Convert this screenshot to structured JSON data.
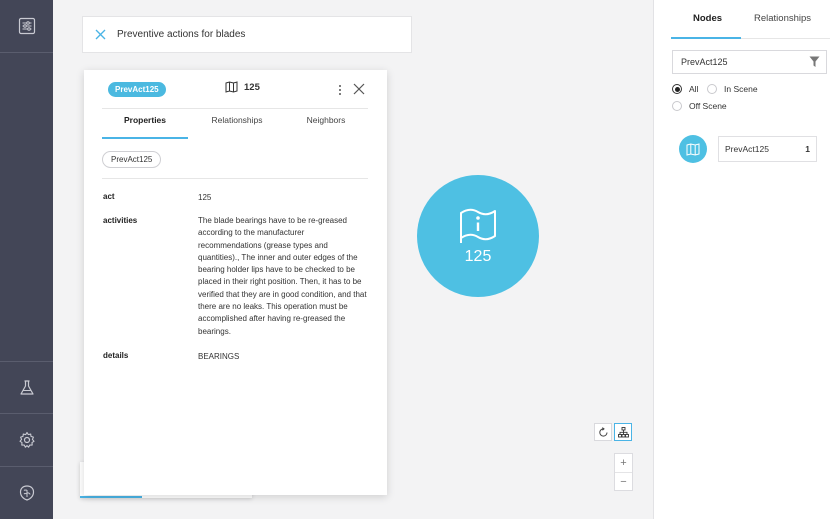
{
  "search": {
    "query": "Preventive actions for blades"
  },
  "card": {
    "badge": "PrevAct125",
    "title": "125",
    "tabs": [
      "Properties",
      "Relationships",
      "Neighbors"
    ],
    "active_tab": "Properties",
    "chip": "PrevAct125",
    "properties": [
      {
        "key": "act",
        "value": "125"
      },
      {
        "key": "activities",
        "value": "The blade bearings have to be re-greased according to the manufacturer recommendations (grease types and quantities)., The inner and outer edges of the bearing holder lips have to be checked to be placed in their right position. Then, it has to be verified that they are in good condition, and that there are no leaks. This operation must be accomplished after having re-greased the bearings."
      },
      {
        "key": "details",
        "value": "BEARINGS"
      }
    ]
  },
  "node": {
    "label": "125",
    "icon": "info-flag-icon",
    "color": "#4ec0e3"
  },
  "zoom": {
    "in": "+",
    "out": "−"
  },
  "right_panel": {
    "tabs": [
      "Nodes",
      "Relationships"
    ],
    "active_tab": "Nodes",
    "filter_value": "PrevAct125",
    "radios": [
      {
        "label": "All",
        "checked": true
      },
      {
        "label": "In Scene",
        "checked": false
      },
      {
        "label": "Off Scene",
        "checked": false
      }
    ],
    "items": [
      {
        "label": "PrevAct125",
        "count": "1"
      }
    ]
  },
  "colors": {
    "sidebar": "#434657",
    "accent": "#4ab4e6",
    "node": "#4ec0e3"
  }
}
